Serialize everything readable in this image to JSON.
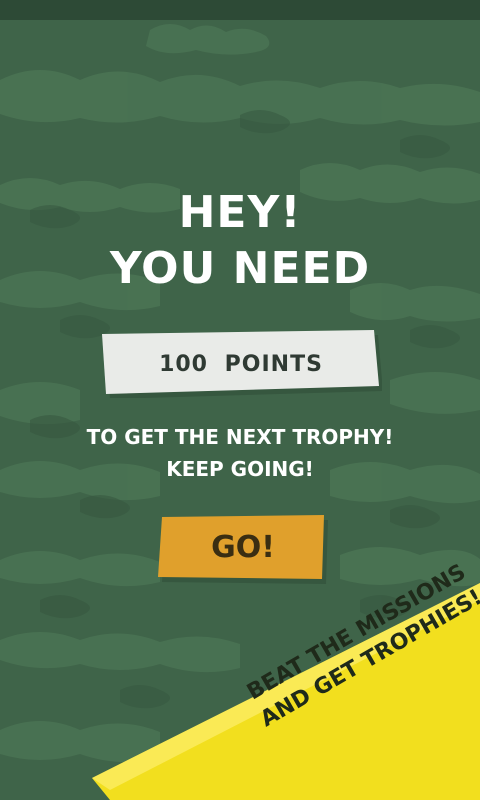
{
  "headline": {
    "line1": "HEY!",
    "line2": "YOU NEED"
  },
  "points": {
    "label": "100  POINTS",
    "value": 100
  },
  "subtitle": {
    "line1": "TO GET THE NEXT TROPHY!",
    "line2": "KEEP GOING!"
  },
  "go_button": {
    "label": "GO!"
  },
  "banner": {
    "line1": "BEAT THE MISSIONS",
    "line2": "AND GET TROPHIES!"
  },
  "colors": {
    "background": "#3f6449",
    "pattern": "#4c7555",
    "points_box": "#e9ebe8",
    "go_button": "#e0a02c",
    "banner": "#f2df1e"
  }
}
